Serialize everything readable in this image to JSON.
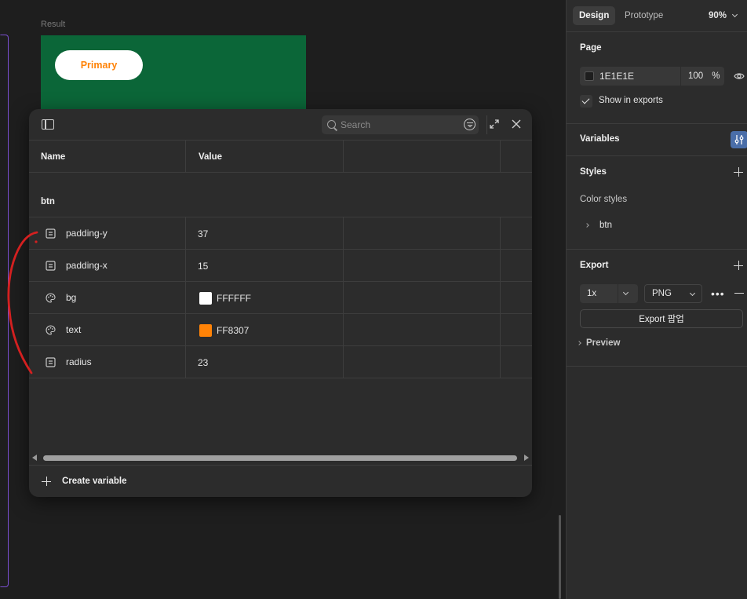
{
  "canvas": {
    "result_label": "Result",
    "preview_button_label": "Primary",
    "frame_color": "#0b6638",
    "button_text_color": "#ff8307"
  },
  "variables_modal": {
    "search": {
      "placeholder": "Search"
    },
    "columns": {
      "name": "Name",
      "value": "Value"
    },
    "group": "btn",
    "variables": [
      {
        "name": "padding-y",
        "type": "number",
        "icon": "number-variable-icon",
        "value": "37"
      },
      {
        "name": "padding-x",
        "type": "number",
        "icon": "number-variable-icon",
        "value": "15"
      },
      {
        "name": "bg",
        "type": "color",
        "icon": "color-variable-icon",
        "value": "FFFFFF",
        "swatch": "#FFFFFF"
      },
      {
        "name": "text",
        "type": "color",
        "icon": "color-variable-icon",
        "value": "FF8307",
        "swatch": "#FF8307"
      },
      {
        "name": "radius",
        "type": "number",
        "icon": "number-variable-icon",
        "value": "23"
      }
    ],
    "create_label": "Create variable"
  },
  "right_panel": {
    "tabs": {
      "design": "Design",
      "prototype": "Prototype"
    },
    "zoom": "90%",
    "page": {
      "title": "Page",
      "color_value": "1E1E1E",
      "opacity": "100",
      "opacity_unit": "%",
      "show_in_exports": "Show in exports"
    },
    "variables_title": "Variables",
    "styles": {
      "title": "Styles",
      "color_styles_label": "Color styles",
      "items": [
        "btn"
      ]
    },
    "export": {
      "title": "Export",
      "scale": "1x",
      "format": "PNG",
      "more": "•••",
      "button_label": "Export 팝업",
      "preview_label": "Preview"
    }
  }
}
